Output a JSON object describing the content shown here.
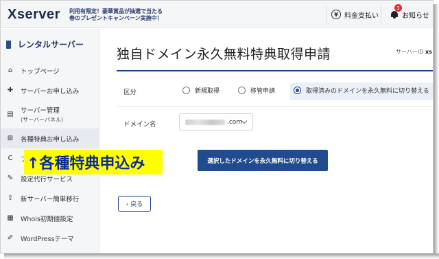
{
  "header": {
    "logo_text": "Xserver",
    "promo_line1": "利用有限定！豪華賞品が抽選で当たる",
    "promo_line2": "春のプレゼントキャンペーン実施中！",
    "pay_label": "料金支払い",
    "pay_icon": "yen-coin-icon",
    "notice_label": "お知らせ",
    "notice_icon": "bell-icon",
    "notice_count": "3"
  },
  "sidebar": {
    "title": "レンタルサーバー",
    "items": [
      {
        "label": "トップページ",
        "icon": "home-icon",
        "glyph": "⌂"
      },
      {
        "label": "サーバーお申し込み",
        "icon": "plus-circle-icon",
        "glyph": "✚"
      },
      {
        "label": "サーバー管理",
        "sub": "(サーバーパネル)",
        "icon": "server-icon",
        "glyph": "▤"
      },
      {
        "label": "各種特典お申し込み",
        "icon": "gift-icon",
        "glyph": "⊞"
      },
      {
        "label": "プ",
        "icon": "refresh-icon",
        "glyph": "C"
      },
      {
        "label": "設定代行サービス",
        "icon": "wrench-icon",
        "glyph": "✎"
      },
      {
        "label": "新サーバー簡単移行",
        "icon": "move-icon",
        "glyph": "⇪"
      },
      {
        "label": "Whois初期値設定",
        "icon": "document-icon",
        "glyph": "▦"
      },
      {
        "label": "WordPressテーマ",
        "icon": "edit-icon",
        "glyph": "✐"
      }
    ]
  },
  "annotation": "↑各種特典申込み",
  "main": {
    "title": "独自ドメイン永久無料特典取得申請",
    "server_id_label": "サーバーID",
    "server_id_value": "xs",
    "kubun_label": "区分",
    "radios": [
      {
        "label": "新規取得",
        "selected": false
      },
      {
        "label": "移管申請",
        "selected": false
      },
      {
        "label": "取得済みのドメインを永久無料に切り替える",
        "selected": true
      }
    ],
    "domain_label": "ドメイン名",
    "domain_value_suffix": ".com",
    "submit_label": "選択したドメインを永久無料に切り替える",
    "back_label": "‹ 戻る"
  }
}
